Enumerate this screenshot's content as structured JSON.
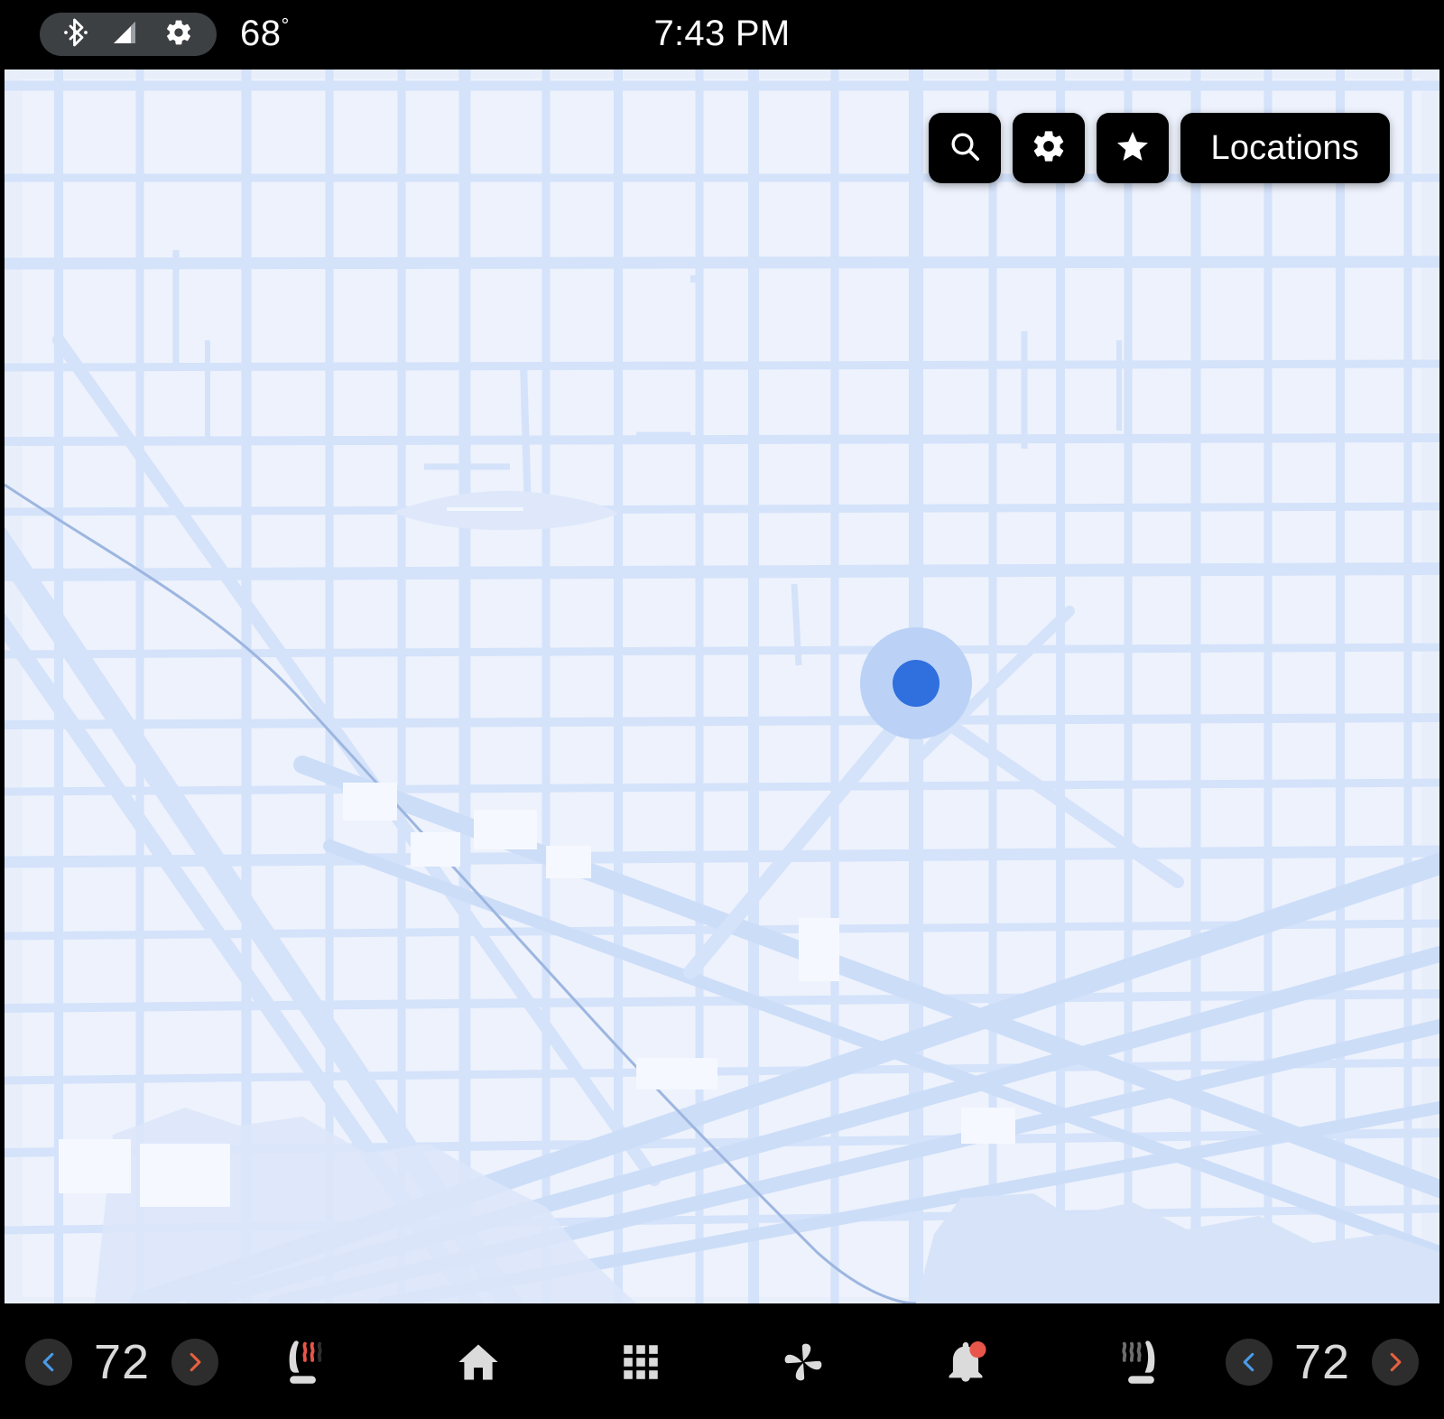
{
  "status_bar": {
    "bluetooth_icon": "bluetooth-icon",
    "signal_icon": "signal-icon",
    "settings_icon": "gear-icon",
    "outside_temp": "68",
    "degree_symbol": "°",
    "clock": "7:43 PM"
  },
  "map": {
    "app": "Maps",
    "toolbar": {
      "search_icon": "search-icon",
      "settings_icon": "gear-icon",
      "favorites_icon": "star-icon",
      "locations_label": "Locations"
    },
    "marker": {
      "name": "current-location-marker",
      "dot_color": "#2F6FDE",
      "halo_color": "#BBD2F6"
    },
    "colors": {
      "land": "#E9EFFA",
      "block": "#EDF2FC",
      "road": "#D4E2FA",
      "major_road": "#CCDDF8",
      "water": "#D7E3F8",
      "river_line": "#9DB6E0"
    }
  },
  "bottom_bar": {
    "left_climate": {
      "decrease_label": "‹",
      "temperature": "72",
      "increase_label": "›",
      "decrease_color": "#4A9BE8",
      "increase_color": "#E8603F"
    },
    "left_seat": {
      "icon": "heated-seat-icon",
      "active_waves": 2,
      "total_waves": 3,
      "active_color": "#E8554A",
      "inactive_color": "#2F2F2F"
    },
    "nav": [
      {
        "icon": "home-icon",
        "label": "Home"
      },
      {
        "icon": "apps-grid-icon",
        "label": "Apps"
      },
      {
        "icon": "fan-icon",
        "label": "Climate"
      },
      {
        "icon": "bell-icon",
        "label": "Notifications",
        "badge": true
      }
    ],
    "right_seat": {
      "icon": "heated-seat-icon",
      "active_waves": 0,
      "total_waves": 3,
      "inactive_color": "#6E6E6E"
    },
    "right_climate": {
      "decrease_label": "‹",
      "temperature": "72",
      "increase_label": "›",
      "decrease_color": "#4A9BE8",
      "increase_color": "#E8603F"
    }
  }
}
